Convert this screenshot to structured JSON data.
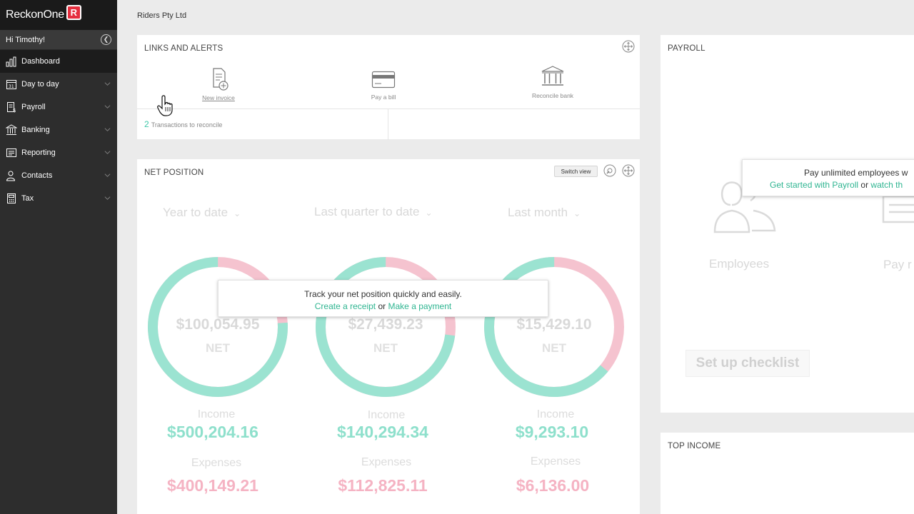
{
  "app": {
    "logo_text": "ReckonOne",
    "logo_badge": "R",
    "greeting": "Hi Timothy!",
    "company": "Riders Pty Ltd"
  },
  "sidebar": {
    "items": [
      {
        "label": "Dashboard",
        "icon": "bar-chart-icon",
        "active": true
      },
      {
        "label": "Day to day",
        "icon": "calendar-icon"
      },
      {
        "label": "Payroll",
        "icon": "payslip-icon"
      },
      {
        "label": "Banking",
        "icon": "bank-icon"
      },
      {
        "label": "Reporting",
        "icon": "report-icon"
      },
      {
        "label": "Contacts",
        "icon": "contacts-icon"
      },
      {
        "label": "Tax",
        "icon": "calculator-icon"
      }
    ]
  },
  "links_alerts": {
    "title": "LINKS AND ALERTS",
    "links": [
      {
        "label": "New invoice",
        "icon": "new-invoice-icon"
      },
      {
        "label": "Pay a bill",
        "icon": "credit-card-icon"
      },
      {
        "label": "Reconcile bank",
        "icon": "bank-icon"
      }
    ],
    "transactions_count": "2",
    "transactions_label": "Transactions to reconcile"
  },
  "net_position": {
    "title": "NET POSITION",
    "switch_view": "Switch view",
    "net_label": "NET",
    "income_label": "Income",
    "expenses_label": "Expenses",
    "periods": [
      {
        "label": "Year to date",
        "net": "$100,054.95",
        "income": "$500,204.16",
        "expenses": "$400,149.21",
        "income_fraction": 0.76
      },
      {
        "label": "Last quarter to date",
        "net": "$27,439.23",
        "income": "$140,294.34",
        "expenses": "$112,825.11",
        "income_fraction": 0.73
      },
      {
        "label": "Last month",
        "net": "$15,429.10",
        "income": "$9,293.10",
        "expenses": "$6,136.00",
        "income_fraction": 0.64
      }
    ],
    "overlay_text": "Track your net position quickly and easily.",
    "overlay_link1": "Create a receipt",
    "overlay_or": "or",
    "overlay_link2": "Make a payment"
  },
  "payroll": {
    "title": "PAYROLL",
    "overlay_text": "Pay unlimited employees w",
    "overlay_link1": "Get started with Payroll",
    "overlay_or": "or",
    "overlay_link2": "watch th",
    "employees_label": "Employees",
    "pay_label": "Pay r",
    "checklist_label": "Set up checklist"
  },
  "top_income": {
    "title": "TOP INCOME"
  },
  "colors": {
    "income": "#9be3d1",
    "expense": "#f5c3cf",
    "link": "#2fb591",
    "sidebar": "#2d2d2d"
  }
}
